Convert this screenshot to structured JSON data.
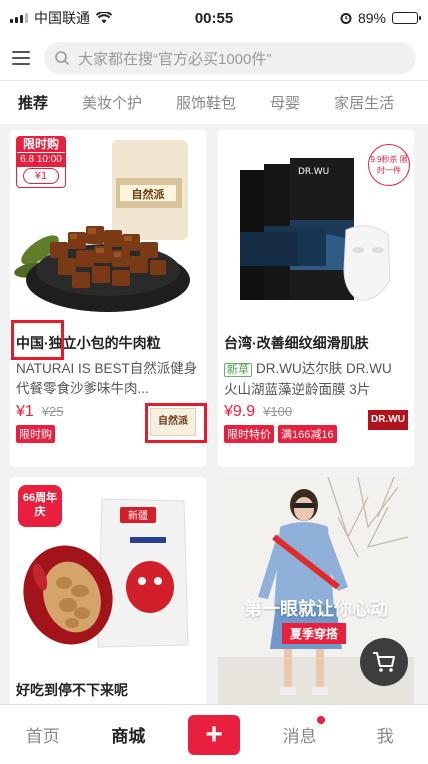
{
  "status": {
    "carrier": "中国联通",
    "time": "00:55",
    "battery": "89%"
  },
  "search": {
    "placeholder": "大家都在搜“官方必买1000件”"
  },
  "tabs": [
    {
      "label": "推荐"
    },
    {
      "label": "美妆个护"
    },
    {
      "label": "服饰鞋包"
    },
    {
      "label": "母婴"
    },
    {
      "label": "家居生活"
    }
  ],
  "products": [
    {
      "badge": "限时购",
      "badge_time": "6.8 10:00",
      "badge_price": "¥1",
      "title": "中国·独立小包的牛肉粒",
      "desc": "NATURAI IS BEST自然派健身代餐零食沙爹味牛肉...",
      "price": "¥1",
      "orig": "¥25",
      "tags": [
        "限时购"
      ],
      "brand": "自然派"
    },
    {
      "title": "台湾·改善细纹细滑肌肤",
      "new_tag": "新草",
      "desc": "DR.WU达尔肤 DR.WU 火山湖蓝藻逆龄面膜 3片",
      "price": "¥9.9",
      "orig": "¥100",
      "tags": [
        "限时特价",
        "满166减16"
      ],
      "brand": "DR.WU",
      "sticker": "9.9秒杀 限时一件",
      "pack_text": "DR.WU"
    },
    {
      "badge": "66周年庆",
      "title": "好吃到停不下来呢",
      "pack_text": "新疆"
    },
    {
      "banner_text": "第一眼就让你心动",
      "banner_tag": "夏季穿搭"
    }
  ],
  "bottom_nav": {
    "home": "首页",
    "mall": "商城",
    "add": "+",
    "messages": "消息",
    "me": "我"
  },
  "colors": {
    "accent": "#e8203d",
    "fab": "#3d3d3d"
  }
}
